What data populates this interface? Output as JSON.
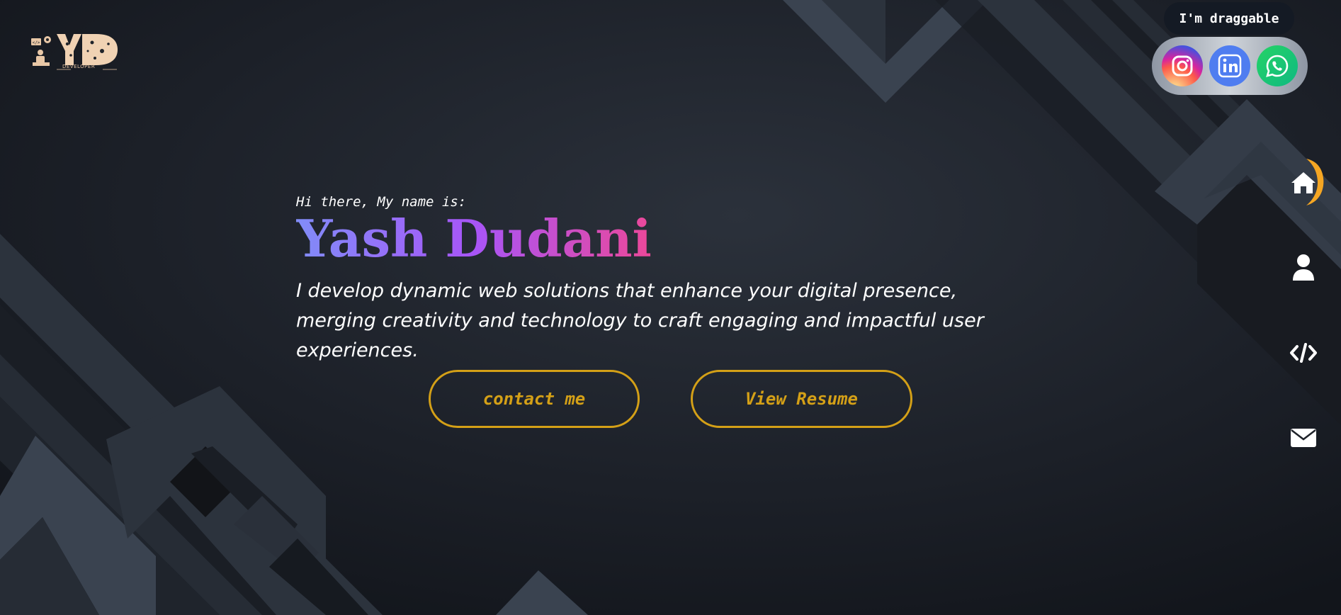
{
  "logo": {
    "text": "YD",
    "subtext": "DEVELOPER"
  },
  "hero": {
    "greeting": "Hi there, My name is:",
    "name": "Yash Dudani",
    "tagline": "I develop dynamic web solutions that enhance your digital presence, merging creativity and technology to craft engaging and impactful user experiences."
  },
  "buttons": {
    "contact_label": "contact me",
    "resume_label": "View Resume"
  },
  "social": {
    "drag_label": "I'm draggable",
    "items": [
      {
        "icon": "instagram-icon"
      },
      {
        "icon": "linkedin-icon"
      },
      {
        "icon": "whatsapp-icon"
      }
    ]
  },
  "nav": {
    "items": [
      {
        "icon": "home-icon",
        "active": true
      },
      {
        "icon": "user-icon",
        "active": false
      },
      {
        "icon": "code-icon",
        "active": false
      },
      {
        "icon": "envelope-icon",
        "active": false
      }
    ]
  },
  "colors": {
    "accent": "#d4a017",
    "background": "#1f232a",
    "name_gradient": [
      "#818cf8",
      "#a855f7",
      "#ec4899"
    ]
  }
}
